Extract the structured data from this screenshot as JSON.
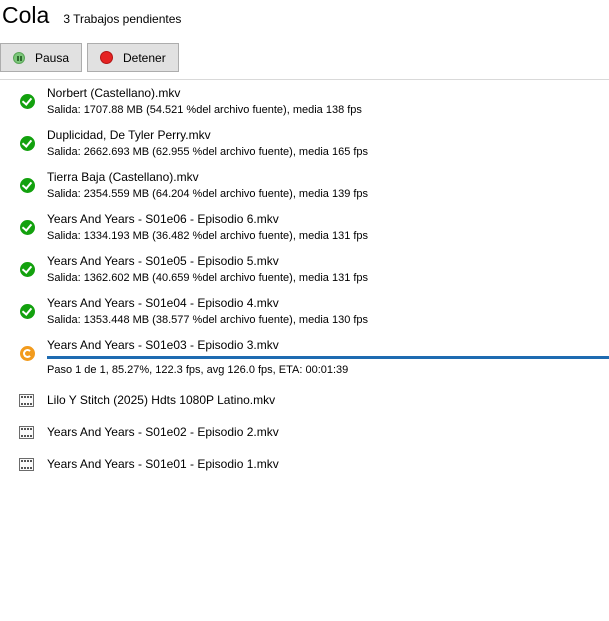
{
  "header": {
    "title": "Cola",
    "pending": "3 Trabajos pendientes"
  },
  "toolbar": {
    "pause_label": "Pausa",
    "stop_label": "Detener"
  },
  "queue": [
    {
      "name": "Norbert (Castellano).mkv",
      "detail": "Salida: 1707.88 MB (54.521 %del archivo fuente), media 138 fps",
      "status": "done"
    },
    {
      "name": "Duplicidad, De Tyler Perry.mkv",
      "detail": "Salida: 2662.693 MB (62.955 %del archivo fuente), media 165 fps",
      "status": "done"
    },
    {
      "name": "Tierra Baja (Castellano).mkv",
      "detail": "Salida: 2354.559 MB (64.204 %del archivo fuente), media 139 fps",
      "status": "done"
    },
    {
      "name": "Years And Years - S01e06 - Episodio 6.mkv",
      "detail": "Salida: 1334.193 MB (36.482 %del archivo fuente), media 131 fps",
      "status": "done"
    },
    {
      "name": "Years And Years - S01e05 - Episodio 5.mkv",
      "detail": "Salida: 1362.602 MB (40.659 %del archivo fuente), media 131 fps",
      "status": "done"
    },
    {
      "name": "Years And Years - S01e04 - Episodio 4.mkv",
      "detail": "Salida: 1353.448 MB (38.577 %del archivo fuente), media 130 fps",
      "status": "done"
    },
    {
      "name": "Years And Years - S01e03 - Episodio 3.mkv",
      "detail": "Paso 1 de 1, 85.27%, 122.3 fps, avg 126.0 fps, ETA: 00:01:39",
      "status": "encoding"
    },
    {
      "name": "Lilo Y Stitch (2025) Hdts 1080P Latino.mkv",
      "status": "pending"
    },
    {
      "name": "Years And Years - S01e02 - Episodio 2.mkv",
      "status": "pending"
    },
    {
      "name": "Years And Years - S01e01 - Episodio 1.mkv",
      "status": "pending"
    }
  ]
}
